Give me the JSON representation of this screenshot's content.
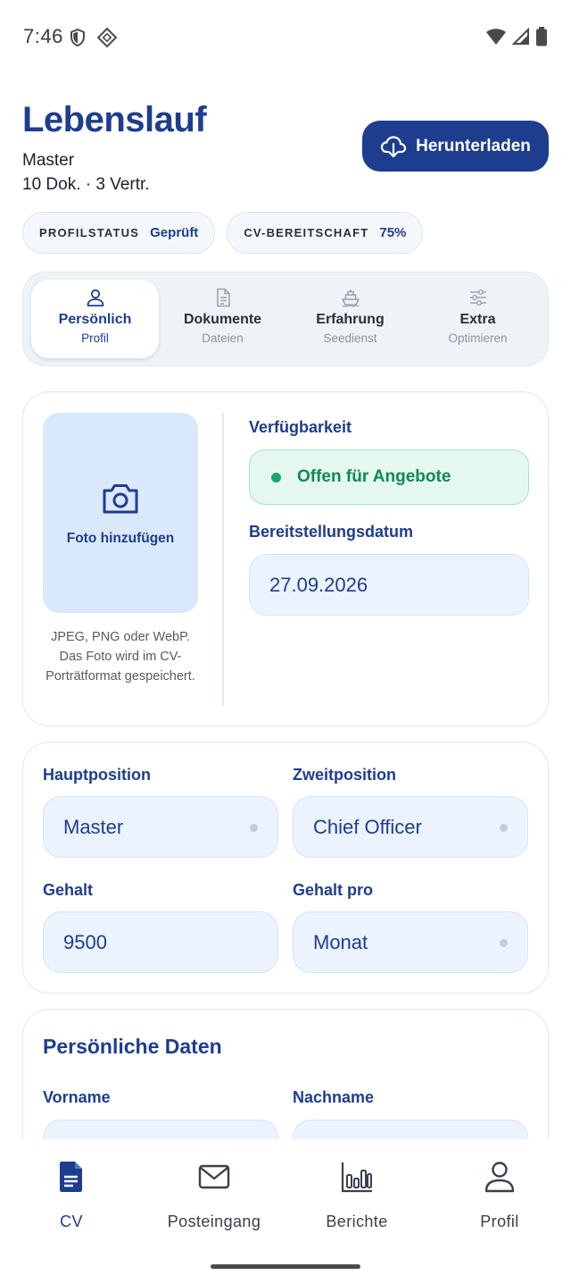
{
  "status_bar": {
    "time": "7:46"
  },
  "header": {
    "title": "Lebenslauf",
    "rank": "Master",
    "summary": "10 Dok. · 3 Vertr.",
    "download_label": "Herunterladen"
  },
  "chips": [
    {
      "key": "PROFILSTATUS",
      "value": "Geprüft"
    },
    {
      "key": "CV-BEREITSCHAFT",
      "value": "75%"
    }
  ],
  "tabs": [
    {
      "label": "Persönlich",
      "sub": "Profil",
      "icon": "person-icon",
      "active": true
    },
    {
      "label": "Dokumente",
      "sub": "Dateien",
      "icon": "document-icon"
    },
    {
      "label": "Erfahrung",
      "sub": "Seedienst",
      "icon": "ship-icon"
    },
    {
      "label": "Extra",
      "sub": "Optimieren",
      "icon": "sliders-icon"
    }
  ],
  "photo": {
    "label": "Foto hinzufügen",
    "note": "JPEG, PNG oder WebP. Das Foto wird im CV-Porträtformat gespeichert."
  },
  "availability": {
    "label": "Verfügbarkeit",
    "value": "Offen für Angebote",
    "color": "#15a86a"
  },
  "readiness_date": {
    "label": "Bereitstellungsdatum",
    "value": "27.09.2026"
  },
  "positions": {
    "main_label": "Hauptposition",
    "main_value": "Master",
    "second_label": "Zweitposition",
    "second_value": "Chief Officer",
    "salary_label": "Gehalt",
    "salary_value": "9500",
    "salary_per_label": "Gehalt pro",
    "salary_per_value": "Monat"
  },
  "personal": {
    "title": "Persönliche Daten",
    "first_name_label": "Vorname",
    "last_name_label": "Nachname"
  },
  "bottom_nav": [
    {
      "label": "CV",
      "icon": "cv-document-icon",
      "active": true
    },
    {
      "label": "Posteingang",
      "icon": "mail-icon"
    },
    {
      "label": "Berichte",
      "icon": "bar-chart-icon"
    },
    {
      "label": "Profil",
      "icon": "person-icon"
    }
  ],
  "colors": {
    "primary": "#1e3d8f",
    "success": "#15a86a",
    "field_bg": "#ebf3fe"
  }
}
